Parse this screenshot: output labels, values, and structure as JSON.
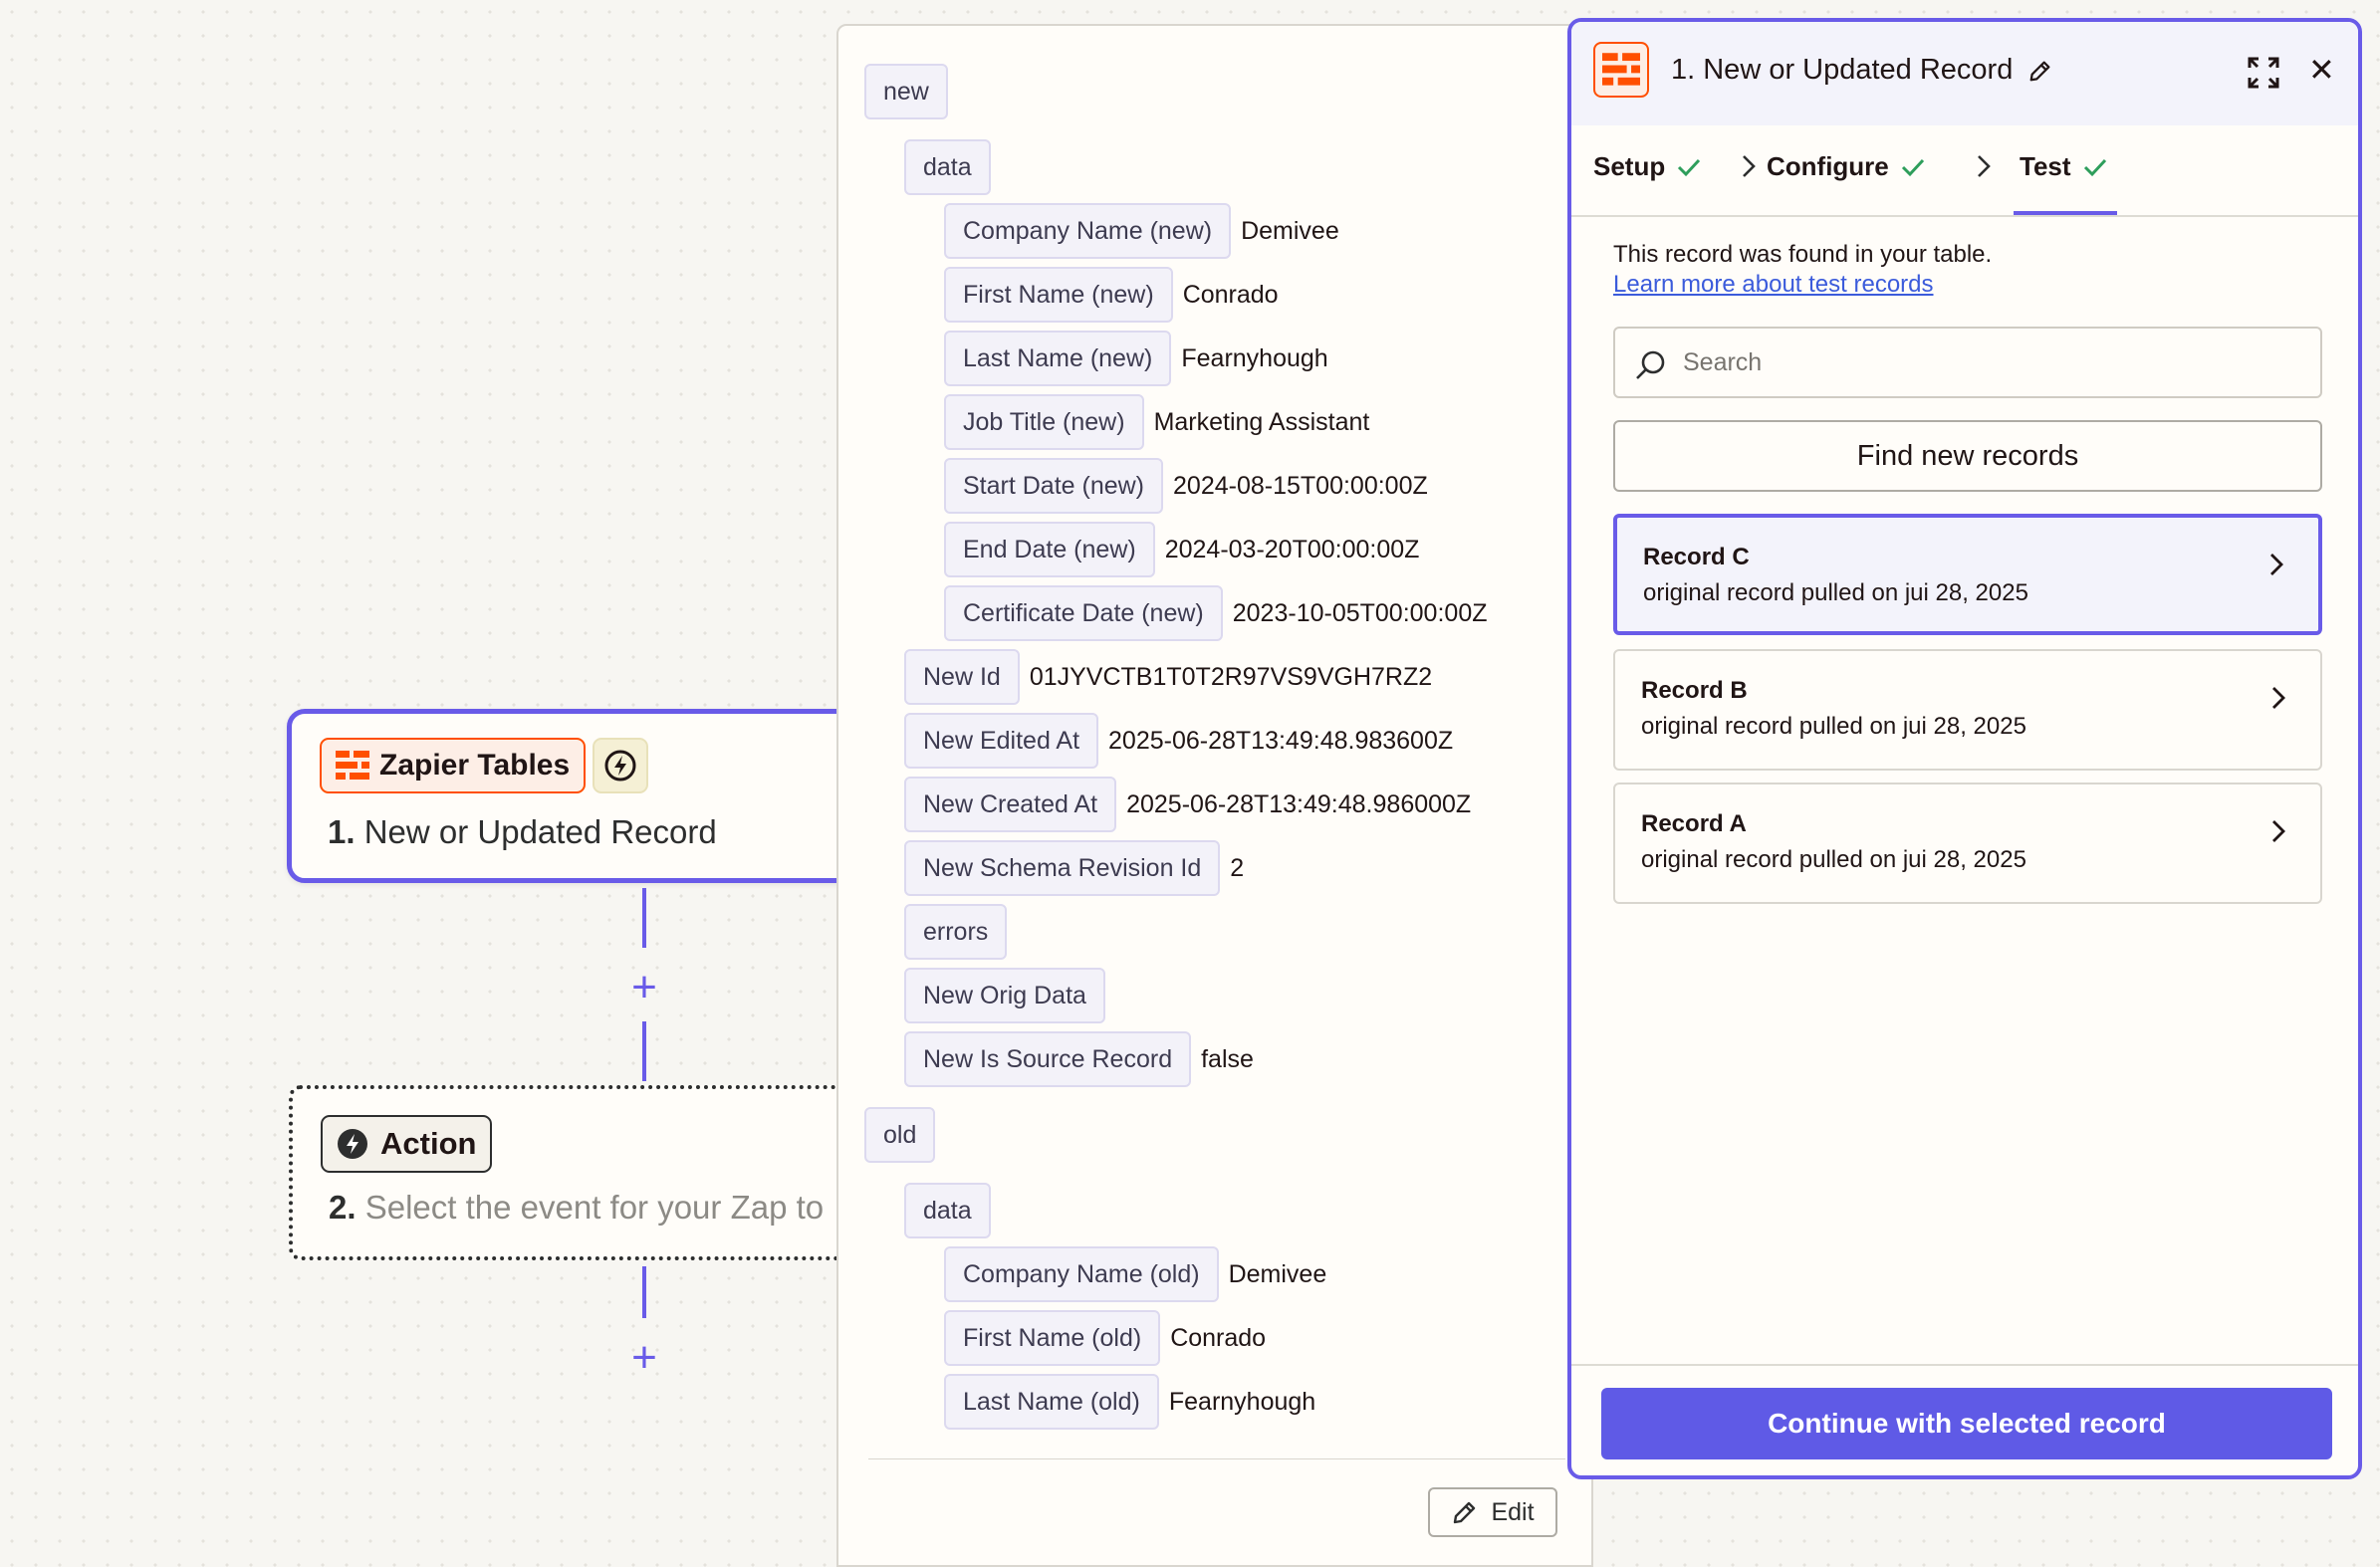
{
  "canvas": {
    "trigger": {
      "app_name": "Zapier Tables",
      "step_number": "1.",
      "step_title": "New or Updated Record"
    },
    "action": {
      "chip_label": "Action",
      "step_number": "2.",
      "step_title": "Select the event for your Zap to"
    }
  },
  "data_panel": {
    "sections": {
      "new": "new",
      "new_data": "data",
      "old": "old",
      "old_data": "data"
    },
    "new_data_fields": [
      {
        "key": "Company Name (new)",
        "value": "Demivee"
      },
      {
        "key": "First Name (new)",
        "value": "Conrado"
      },
      {
        "key": "Last Name (new)",
        "value": "Fearnyhough"
      },
      {
        "key": "Job Title (new)",
        "value": "Marketing Assistant"
      },
      {
        "key": "Start Date (new)",
        "value": "2024-08-15T00:00:00Z"
      },
      {
        "key": "End Date (new)",
        "value": "2024-03-20T00:00:00Z"
      },
      {
        "key": "Certificate Date (new)",
        "value": "2023-10-05T00:00:00Z"
      }
    ],
    "new_fields": [
      {
        "key": "New Id",
        "value": "01JYVCTB1T0T2R97VS9VGH7RZ2"
      },
      {
        "key": "New Edited At",
        "value": "2025-06-28T13:49:48.983600Z"
      },
      {
        "key": "New Created At",
        "value": "2025-06-28T13:49:48.986000Z"
      },
      {
        "key": "New Schema Revision Id",
        "value": "2"
      },
      {
        "key": "errors",
        "value": ""
      },
      {
        "key": "New Orig Data",
        "value": ""
      },
      {
        "key": "New Is Source Record",
        "value": "false"
      }
    ],
    "old_data_fields": [
      {
        "key": "Company Name (old)",
        "value": "Demivee"
      },
      {
        "key": "First Name (old)",
        "value": "Conrado"
      },
      {
        "key": "Last Name (old)",
        "value": "Fearnyhough"
      }
    ],
    "edit_label": "Edit"
  },
  "side_panel": {
    "title": "1. New or Updated Record",
    "tabs": [
      {
        "label": "Setup"
      },
      {
        "label": "Configure"
      },
      {
        "label": "Test"
      }
    ],
    "active_tab": "Test",
    "found_text": "This record was found in your table.",
    "learn_link": "Learn more about test records",
    "search_placeholder": "Search",
    "find_button": "Find new records",
    "records": [
      {
        "name": "Record C",
        "subtitle": "original record pulled on jui 28, 2025",
        "selected": true
      },
      {
        "name": "Record B",
        "subtitle": "original record pulled on jui 28, 2025",
        "selected": false
      },
      {
        "name": "Record A",
        "subtitle": "original record pulled on jui 28, 2025",
        "selected": false
      }
    ],
    "continue_button": "Continue with selected record"
  },
  "colors": {
    "accent": "#695be8",
    "primary_button": "#5f5ae6",
    "brand_orange": "#ff4f00",
    "success_check": "#2e9e5b"
  },
  "icons": [
    "zapier-tables-logo-icon",
    "bolt-icon",
    "plus-icon",
    "pencil-icon",
    "expand-icon",
    "close-icon",
    "check-icon",
    "chevron-right-icon",
    "search-icon"
  ]
}
